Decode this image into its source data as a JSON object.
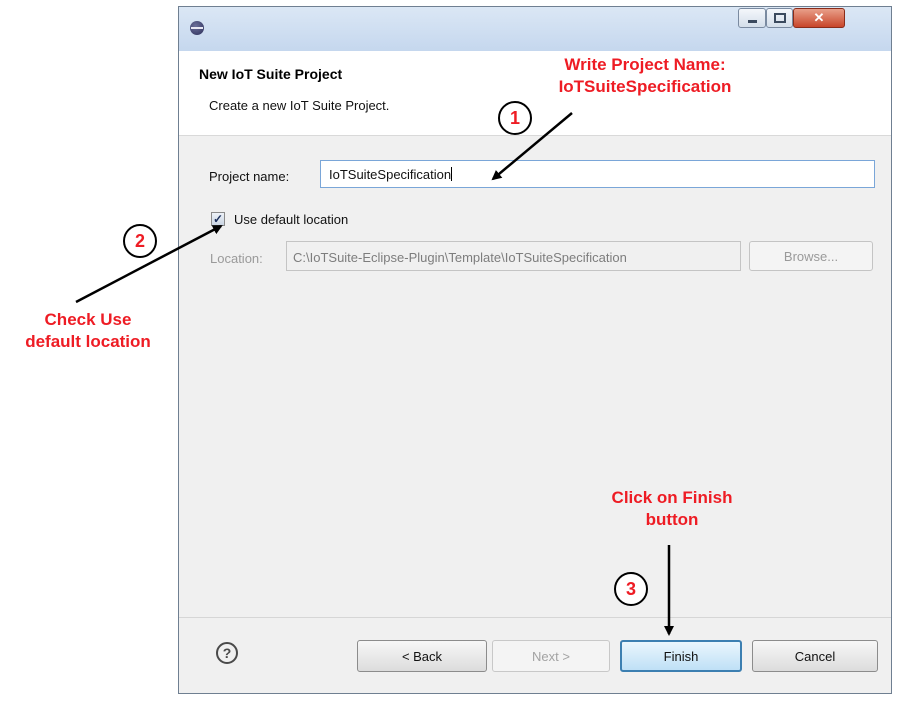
{
  "window": {
    "app_icon": "eclipse-icon",
    "controls": {
      "minimize": "minimize-icon",
      "maximize": "maximize-icon",
      "close": "✕"
    }
  },
  "header": {
    "title": "New IoT Suite Project",
    "description": "Create a new IoT Suite Project."
  },
  "form": {
    "project_name_label": "Project name:",
    "project_name_value": "IoTSuiteSpecification",
    "use_default_location_label": "Use default location",
    "use_default_location_checked": true,
    "checkbox_glyph": "✓",
    "location_label": "Location:",
    "location_value": "C:\\IoTSuite-Eclipse-Plugin\\Template\\IoTSuiteSpecification",
    "browse_label": "Browse..."
  },
  "footer": {
    "help_icon": "?",
    "back_label": "< Back",
    "next_label": "Next >",
    "finish_label": "Finish",
    "cancel_label": "Cancel"
  },
  "annotations": {
    "color": "#ee1c24",
    "step1_number": "1",
    "step1_line1": "Write Project Name:",
    "step1_line2": "IoTSuiteSpecification",
    "step2_number": "2",
    "step2_line1": "Check Use",
    "step2_line2": "default location",
    "step3_number": "3",
    "step3_line1": "Click on Finish",
    "step3_line2": "button"
  }
}
